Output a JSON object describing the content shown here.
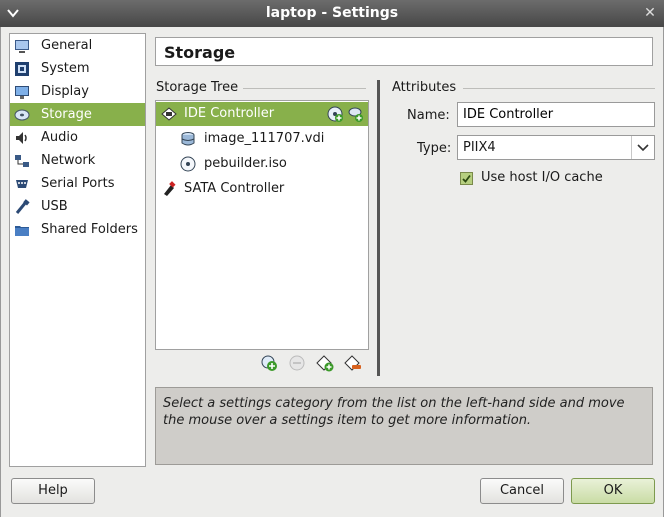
{
  "window": {
    "title": "laptop - Settings"
  },
  "categories": [
    {
      "label": "General",
      "icon": "monitor-general-icon"
    },
    {
      "label": "System",
      "icon": "chip-icon"
    },
    {
      "label": "Display",
      "icon": "display-icon"
    },
    {
      "label": "Storage",
      "icon": "storage-disk-icon",
      "selected": true
    },
    {
      "label": "Audio",
      "icon": "speaker-icon"
    },
    {
      "label": "Network",
      "icon": "network-icon"
    },
    {
      "label": "Serial Ports",
      "icon": "serial-port-icon"
    },
    {
      "label": "USB",
      "icon": "usb-icon"
    },
    {
      "label": "Shared Folders",
      "icon": "folder-icon"
    }
  ],
  "page": {
    "title": "Storage"
  },
  "storage_tree": {
    "label": "Storage Tree",
    "items": [
      {
        "label": "IDE Controller",
        "icon": "ide-controller-icon",
        "level": 0,
        "selected": true
      },
      {
        "label": "image_111707.vdi",
        "icon": "hard-disk-icon",
        "level": 1
      },
      {
        "label": "pebuilder.iso",
        "icon": "cd-icon",
        "level": 1
      },
      {
        "label": "SATA Controller",
        "icon": "sata-controller-icon",
        "level": 0
      }
    ]
  },
  "attributes": {
    "label": "Attributes",
    "name_label": "Name:",
    "name_value": "IDE Controller",
    "type_label": "Type:",
    "type_value": "PIIX4",
    "host_io_cache_label": "Use host I/O cache",
    "host_io_cache_checked": true
  },
  "info_text": "Select a settings category from the list on the left-hand side and move the mouse over a settings item to get more information.",
  "buttons": {
    "help": "Help",
    "cancel": "Cancel",
    "ok": "OK"
  },
  "colors": {
    "accent": "#88b04b",
    "titlebar": "#4f4f4f"
  }
}
